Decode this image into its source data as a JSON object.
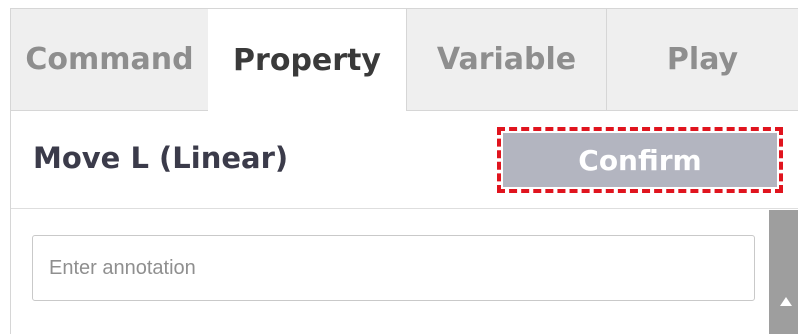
{
  "tabs": [
    {
      "label": "Command",
      "active": false
    },
    {
      "label": "Property",
      "active": true
    },
    {
      "label": "Variable",
      "active": false
    },
    {
      "label": "Play",
      "active": false
    }
  ],
  "property": {
    "title": "Move L (Linear)",
    "confirm_label": "Confirm",
    "annotation_placeholder": "Enter annotation",
    "annotation_value": ""
  },
  "colors": {
    "confirm_bg": "#b3b5c0",
    "highlight": "#e0141e",
    "tab_inactive_bg": "#efefef",
    "scrollbar": "#9e9e9e"
  },
  "icons": {
    "scroll_up": "triangle-up-icon"
  }
}
